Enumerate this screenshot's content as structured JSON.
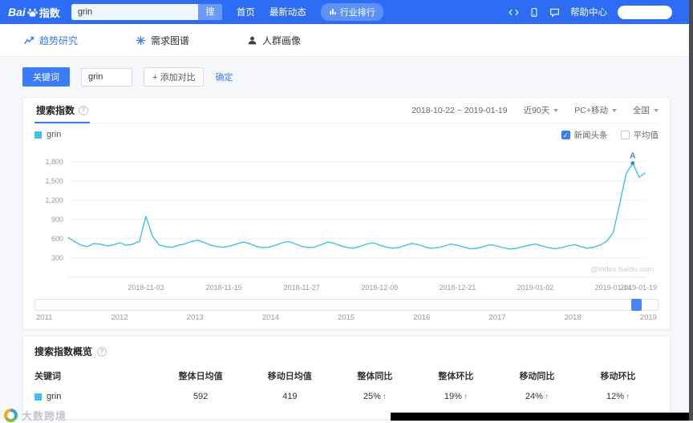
{
  "header": {
    "logo": {
      "left": "Bai",
      "right": "指数"
    },
    "search": {
      "value": "grin",
      "button": "搜索"
    },
    "nav": [
      "首页",
      "最新动态",
      "行业排行"
    ],
    "help": "帮助中心"
  },
  "subnav": {
    "items": [
      {
        "label": "趋势研究",
        "active": true
      },
      {
        "label": "需求图谱",
        "active": false
      },
      {
        "label": "人群画像",
        "active": false
      }
    ]
  },
  "keyword_bar": {
    "label": "关键词",
    "value": "grin",
    "add_compare": "+ 添加对比",
    "confirm": "确定"
  },
  "chart_card": {
    "tab": "搜索指数",
    "date_range": "2018-10-22 ~ 2019-01-19",
    "filters": [
      "近90天",
      "PC+移动",
      "全国"
    ],
    "legend": "grin",
    "toggles": [
      {
        "label": "新闻头条",
        "checked": true
      },
      {
        "label": "平均值",
        "checked": false
      }
    ],
    "watermark": "@index.baidu.com"
  },
  "chart_data": {
    "type": "line",
    "title": "搜索指数",
    "series_name": "grin",
    "start_date": "2018-10-22",
    "end_date": "2019-01-19",
    "color": "#3cc3ec",
    "annotation": {
      "label": "A",
      "at": "max"
    },
    "ylim": [
      0,
      1950
    ],
    "yticks": [
      {
        "v": 300,
        "label": "300"
      },
      {
        "v": 600,
        "label": "600"
      },
      {
        "v": 900,
        "label": "900"
      },
      {
        "v": 1200,
        "label": "1,200"
      },
      {
        "v": 1500,
        "label": "1,500"
      },
      {
        "v": 1800,
        "label": "1,800"
      }
    ],
    "xticks": [
      {
        "i": 12,
        "label": "2018-11-03"
      },
      {
        "i": 24,
        "label": "2018-11-15"
      },
      {
        "i": 36,
        "label": "2018-11-27"
      },
      {
        "i": 48,
        "label": "2018-12-09"
      },
      {
        "i": 60,
        "label": "2018-12-21"
      },
      {
        "i": 72,
        "label": "2019-01-02"
      },
      {
        "i": 84,
        "label": "2019-01-14"
      },
      {
        "i": 89,
        "label": "2019-01-19"
      }
    ],
    "values": [
      620,
      555,
      500,
      478,
      525,
      515,
      488,
      505,
      538,
      498,
      515,
      560,
      950,
      640,
      505,
      478,
      468,
      498,
      520,
      558,
      578,
      540,
      498,
      478,
      468,
      488,
      520,
      548,
      522,
      480,
      460,
      470,
      500,
      538,
      558,
      520,
      480,
      462,
      470,
      508,
      548,
      528,
      490,
      462,
      452,
      480,
      518,
      538,
      500,
      470,
      452,
      462,
      498,
      528,
      508,
      470,
      452,
      462,
      488,
      518,
      498,
      470,
      442,
      452,
      478,
      508,
      488,
      462,
      440,
      450,
      478,
      498,
      518,
      488,
      462,
      442,
      460,
      488,
      508,
      478,
      452,
      470,
      500,
      560,
      700,
      1150,
      1620,
      1780,
      1560,
      1630
    ]
  },
  "timeline": {
    "years": [
      "2011",
      "2012",
      "2013",
      "2014",
      "2015",
      "2016",
      "2017",
      "2018",
      "2019"
    ]
  },
  "overview": {
    "title": "搜索指数概览",
    "columns": [
      "关键词",
      "整体日均值",
      "移动日均值",
      "整体同比",
      "整体环比",
      "移动同比",
      "移动环比"
    ],
    "row": {
      "keyword": "grin",
      "overall_daily_avg": "592",
      "mobile_daily_avg": "419",
      "overall_yoy": "25%",
      "overall_mom": "19%",
      "mobile_yoy": "24%",
      "mobile_mom": "12%"
    }
  },
  "watermark_overlay": {
    "text": "大数跨境"
  },
  "icons": {
    "arrow_up": "↑",
    "check": "✓",
    "question": "?"
  }
}
